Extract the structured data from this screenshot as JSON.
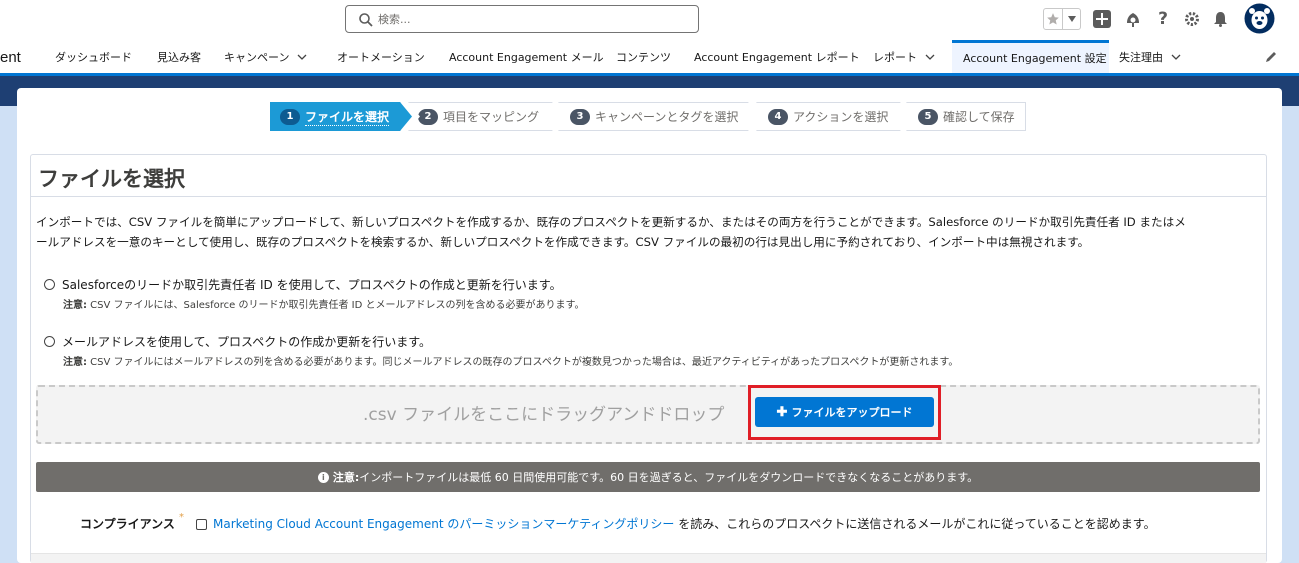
{
  "search": {
    "placeholder": "検索..."
  },
  "header_icons": [
    "star-icon",
    "favorites-dropdown-icon",
    "add-icon",
    "trailhead-icon",
    "help-icon",
    "setup-gear-icon",
    "notification-bell-icon",
    "avatar"
  ],
  "nav": {
    "app_name_fragment": "ent",
    "items": [
      {
        "label": "ダッシュボード",
        "has_menu": false
      },
      {
        "label": "見込み客",
        "has_menu": false
      },
      {
        "label": "キャンペーン",
        "has_menu": true
      },
      {
        "label": "オートメーション",
        "has_menu": false
      },
      {
        "label": "Account Engagement メール",
        "has_menu": false
      },
      {
        "label": "コンテンツ",
        "has_menu": false
      },
      {
        "label": "Account Engagement レポート",
        "has_menu": false
      },
      {
        "label": "レポート",
        "has_menu": true
      },
      {
        "label": "Account Engagement 設定",
        "has_menu": false,
        "active": true
      },
      {
        "label": "失注理由",
        "has_menu": true
      }
    ]
  },
  "steps": [
    {
      "num": "1",
      "label": "ファイルを選択",
      "active": true
    },
    {
      "num": "2",
      "label": "項目をマッピング",
      "active": false
    },
    {
      "num": "3",
      "label": "キャンペーンとタグを選択",
      "active": false
    },
    {
      "num": "4",
      "label": "アクションを選択",
      "active": false
    },
    {
      "num": "5",
      "label": "確認して保存",
      "active": false
    }
  ],
  "panel": {
    "title": "ファイルを選択",
    "intro_line1": "インポートでは、CSV ファイルを簡単にアップロードして、新しいプロスペクトを作成するか、既存のプロスペクトを更新するか、またはその両方を行うことができます。Salesforce のリードか取引先責任者 ID またはメ",
    "intro_line2": "ールアドレスを一意のキーとして使用し、既存のプロスペクトを検索するか、新しいプロスペクトを作成できます。CSV ファイルの最初の行は見出し用に予約されており、インポート中は無視されます。",
    "options": [
      {
        "label": "Salesforceのリードか取引先責任者 ID を使用して、プロスペクトの作成と更新を行います。",
        "note_prefix": "注意:",
        "note": " CSV ファイルには、Salesforce のリードか取引先責任者 ID とメールアドレスの列を含める必要があります。"
      },
      {
        "label": "メールアドレスを使用して、プロスペクトの作成か更新を行います。",
        "note_prefix": "注意:",
        "note": " CSV ファイルにはメールアドレスの列を含める必要があります。同じメールアドレスの既存のプロスペクトが複数見つかった場合は、最近アクティビティがあったプロスペクトが更新されます。"
      }
    ],
    "dropzone_text": ".csv ファイルをここにドラッグアンドドロップ",
    "upload_button": "ファイルをアップロード",
    "warning_prefix": "注意:",
    "warning_text": " インポートファイルは最低 60 日間使用可能です。60 日を過ぎると、ファイルをダウンロードできなくなることがあります。",
    "compliance_label": "コンプライアンス",
    "compliance_required": "*",
    "compliance_link": "Marketing Cloud Account Engagement のパーミッションマーケティングポリシー",
    "compliance_text": " を読み、これらのプロスペクトに送信されるメールがこれに従っていることを認めます。"
  },
  "colors": {
    "brand": "#0176d3",
    "active_step": "#1c9ad6",
    "highlight_box": "#e01e26",
    "warning_bar": "#706e6b"
  }
}
